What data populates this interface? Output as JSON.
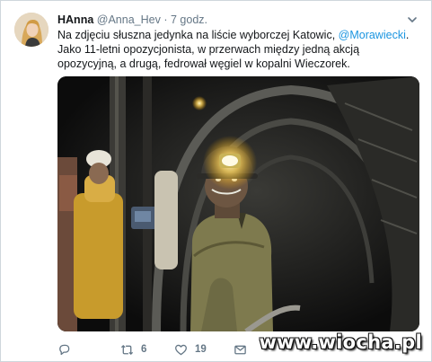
{
  "tweet": {
    "author_name": "HAnna",
    "handle": "@Anna_Hev",
    "separator": "·",
    "time": "7 godz.",
    "line1_prefix": "Na zdjęciu słuszna jedynka na liście wyborczej Katowic, ",
    "line1_mention": "@Morawiecki",
    "line1_suffix": ".",
    "line2": "Jako 11-letni opozycjonista, w przerwach między jedną akcją opozycyjną, a drugą, fedrował węgiel w kopalni Wieczorek."
  },
  "actions": {
    "reply_icon": "reply-icon",
    "retweet_icon": "retweet-icon",
    "retweet_count": "6",
    "like_icon": "heart-icon",
    "like_count": "19",
    "dm_icon": "mail-icon"
  },
  "watermark": "www.wiocha.pl",
  "colors": {
    "link": "#1b95e0",
    "muted": "#657786",
    "text": "#14171a"
  }
}
